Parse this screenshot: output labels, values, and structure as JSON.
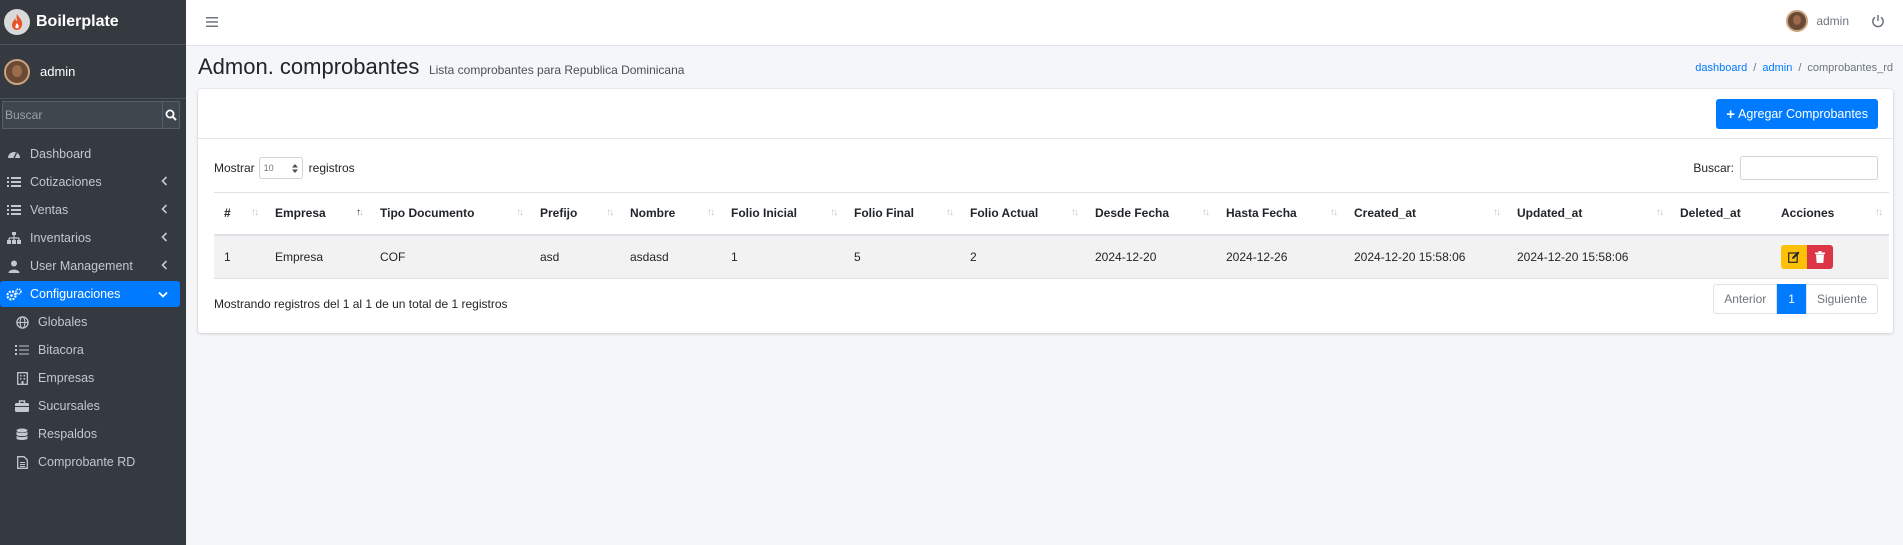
{
  "brand": {
    "name": "Boilerplate"
  },
  "user": {
    "name": "admin"
  },
  "sidebar": {
    "search_placeholder": "Buscar",
    "items": [
      {
        "label": "Dashboard",
        "icon": "dashboard-icon"
      },
      {
        "label": "Cotizaciones",
        "icon": "list-icon"
      },
      {
        "label": "Ventas",
        "icon": "list-icon"
      },
      {
        "label": "Inventarios",
        "icon": "sitemap-icon"
      },
      {
        "label": "User Management",
        "icon": "user-icon"
      },
      {
        "label": "Configuraciones",
        "icon": "cogs-icon"
      }
    ],
    "subitems": [
      {
        "label": "Globales",
        "icon": "globe-icon"
      },
      {
        "label": "Bitacora",
        "icon": "list-icon"
      },
      {
        "label": "Empresas",
        "icon": "building-icon"
      },
      {
        "label": "Sucursales",
        "icon": "briefcase-icon"
      },
      {
        "label": "Respaldos",
        "icon": "database-icon"
      },
      {
        "label": "Comprobante RD",
        "icon": "file-icon"
      }
    ]
  },
  "topbar": {
    "user_name": "admin"
  },
  "header": {
    "title": "Admon. comprobantes",
    "subtitle": "Lista comprobantes para Republica Dominicana",
    "breadcrumb": [
      "dashboard",
      "admin",
      "comprobantes_rd"
    ]
  },
  "toolbar": {
    "add_label": "Agregar Comprobantes"
  },
  "table_controls": {
    "show_label": "Mostrar",
    "page_size": "10",
    "records_label": "registros",
    "search_label": "Buscar:"
  },
  "table": {
    "columns": [
      "#",
      "Empresa",
      "Tipo Documento",
      "Prefijo",
      "Nombre",
      "Folio Inicial",
      "Folio Final",
      "Folio Actual",
      "Desde Fecha",
      "Hasta Fecha",
      "Created_at",
      "Updated_at",
      "Deleted_at",
      "Acciones"
    ],
    "rows": [
      [
        "1",
        "Empresa",
        "COF",
        "asd",
        "asdasd",
        "1",
        "5",
        "2",
        "2024-12-20",
        "2024-12-26",
        "2024-12-20 15:58:06",
        "2024-12-20 15:58:06",
        ""
      ]
    ]
  },
  "footer": {
    "info": "Mostrando registros del 1 al 1 de un total de 1 registros",
    "prev": "Anterior",
    "page": "1",
    "next": "Siguiente"
  },
  "colors": {
    "accent": "#007bff",
    "sidebar_bg": "#343a40",
    "edit": "#ffc107",
    "delete": "#dc3545"
  }
}
